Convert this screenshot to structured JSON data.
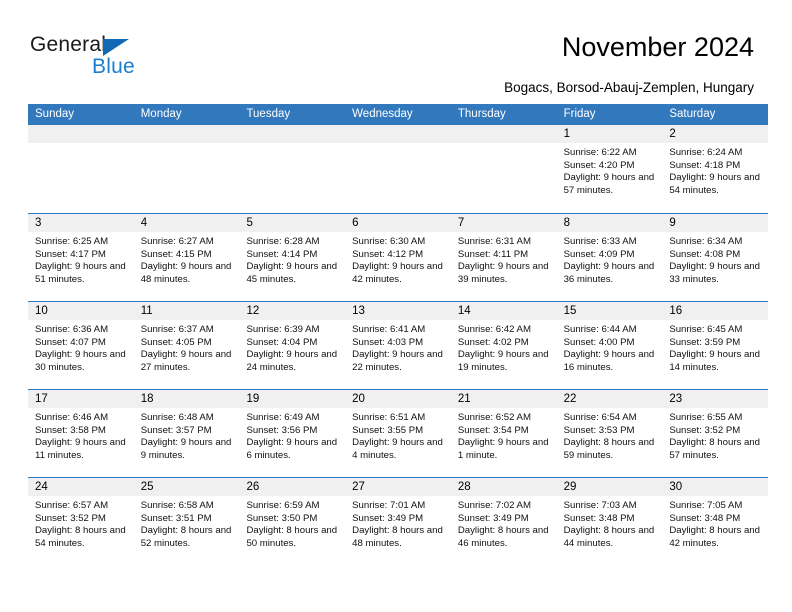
{
  "brand": {
    "name_part1": "General",
    "name_part2": "Blue",
    "accent_color": "#1a7fd4",
    "triangle_color": "#1268b3",
    "triangle_icon": "triangle-icon"
  },
  "header": {
    "title": "November 2024",
    "subtitle": "Bogacs, Borsod-Abauj-Zemplen, Hungary"
  },
  "calendar": {
    "header_bg": "#3278bd",
    "day_band_bg": "#f0f0f0",
    "weekdays": [
      "Sunday",
      "Monday",
      "Tuesday",
      "Wednesday",
      "Thursday",
      "Friday",
      "Saturday"
    ],
    "labels": {
      "sunrise": "Sunrise:",
      "sunset": "Sunset:",
      "daylight": "Daylight:"
    },
    "weeks": [
      [
        {
          "day": "",
          "empty": true
        },
        {
          "day": "",
          "empty": true
        },
        {
          "day": "",
          "empty": true
        },
        {
          "day": "",
          "empty": true
        },
        {
          "day": "",
          "empty": true
        },
        {
          "day": "1",
          "sunrise": "Sunrise: 6:22 AM",
          "sunset": "Sunset: 4:20 PM",
          "daylight": "Daylight: 9 hours and 57 minutes."
        },
        {
          "day": "2",
          "sunrise": "Sunrise: 6:24 AM",
          "sunset": "Sunset: 4:18 PM",
          "daylight": "Daylight: 9 hours and 54 minutes."
        }
      ],
      [
        {
          "day": "3",
          "sunrise": "Sunrise: 6:25 AM",
          "sunset": "Sunset: 4:17 PM",
          "daylight": "Daylight: 9 hours and 51 minutes."
        },
        {
          "day": "4",
          "sunrise": "Sunrise: 6:27 AM",
          "sunset": "Sunset: 4:15 PM",
          "daylight": "Daylight: 9 hours and 48 minutes."
        },
        {
          "day": "5",
          "sunrise": "Sunrise: 6:28 AM",
          "sunset": "Sunset: 4:14 PM",
          "daylight": "Daylight: 9 hours and 45 minutes."
        },
        {
          "day": "6",
          "sunrise": "Sunrise: 6:30 AM",
          "sunset": "Sunset: 4:12 PM",
          "daylight": "Daylight: 9 hours and 42 minutes."
        },
        {
          "day": "7",
          "sunrise": "Sunrise: 6:31 AM",
          "sunset": "Sunset: 4:11 PM",
          "daylight": "Daylight: 9 hours and 39 minutes."
        },
        {
          "day": "8",
          "sunrise": "Sunrise: 6:33 AM",
          "sunset": "Sunset: 4:09 PM",
          "daylight": "Daylight: 9 hours and 36 minutes."
        },
        {
          "day": "9",
          "sunrise": "Sunrise: 6:34 AM",
          "sunset": "Sunset: 4:08 PM",
          "daylight": "Daylight: 9 hours and 33 minutes."
        }
      ],
      [
        {
          "day": "10",
          "sunrise": "Sunrise: 6:36 AM",
          "sunset": "Sunset: 4:07 PM",
          "daylight": "Daylight: 9 hours and 30 minutes."
        },
        {
          "day": "11",
          "sunrise": "Sunrise: 6:37 AM",
          "sunset": "Sunset: 4:05 PM",
          "daylight": "Daylight: 9 hours and 27 minutes."
        },
        {
          "day": "12",
          "sunrise": "Sunrise: 6:39 AM",
          "sunset": "Sunset: 4:04 PM",
          "daylight": "Daylight: 9 hours and 24 minutes."
        },
        {
          "day": "13",
          "sunrise": "Sunrise: 6:41 AM",
          "sunset": "Sunset: 4:03 PM",
          "daylight": "Daylight: 9 hours and 22 minutes."
        },
        {
          "day": "14",
          "sunrise": "Sunrise: 6:42 AM",
          "sunset": "Sunset: 4:02 PM",
          "daylight": "Daylight: 9 hours and 19 minutes."
        },
        {
          "day": "15",
          "sunrise": "Sunrise: 6:44 AM",
          "sunset": "Sunset: 4:00 PM",
          "daylight": "Daylight: 9 hours and 16 minutes."
        },
        {
          "day": "16",
          "sunrise": "Sunrise: 6:45 AM",
          "sunset": "Sunset: 3:59 PM",
          "daylight": "Daylight: 9 hours and 14 minutes."
        }
      ],
      [
        {
          "day": "17",
          "sunrise": "Sunrise: 6:46 AM",
          "sunset": "Sunset: 3:58 PM",
          "daylight": "Daylight: 9 hours and 11 minutes."
        },
        {
          "day": "18",
          "sunrise": "Sunrise: 6:48 AM",
          "sunset": "Sunset: 3:57 PM",
          "daylight": "Daylight: 9 hours and 9 minutes."
        },
        {
          "day": "19",
          "sunrise": "Sunrise: 6:49 AM",
          "sunset": "Sunset: 3:56 PM",
          "daylight": "Daylight: 9 hours and 6 minutes."
        },
        {
          "day": "20",
          "sunrise": "Sunrise: 6:51 AM",
          "sunset": "Sunset: 3:55 PM",
          "daylight": "Daylight: 9 hours and 4 minutes."
        },
        {
          "day": "21",
          "sunrise": "Sunrise: 6:52 AM",
          "sunset": "Sunset: 3:54 PM",
          "daylight": "Daylight: 9 hours and 1 minute."
        },
        {
          "day": "22",
          "sunrise": "Sunrise: 6:54 AM",
          "sunset": "Sunset: 3:53 PM",
          "daylight": "Daylight: 8 hours and 59 minutes."
        },
        {
          "day": "23",
          "sunrise": "Sunrise: 6:55 AM",
          "sunset": "Sunset: 3:52 PM",
          "daylight": "Daylight: 8 hours and 57 minutes."
        }
      ],
      [
        {
          "day": "24",
          "sunrise": "Sunrise: 6:57 AM",
          "sunset": "Sunset: 3:52 PM",
          "daylight": "Daylight: 8 hours and 54 minutes."
        },
        {
          "day": "25",
          "sunrise": "Sunrise: 6:58 AM",
          "sunset": "Sunset: 3:51 PM",
          "daylight": "Daylight: 8 hours and 52 minutes."
        },
        {
          "day": "26",
          "sunrise": "Sunrise: 6:59 AM",
          "sunset": "Sunset: 3:50 PM",
          "daylight": "Daylight: 8 hours and 50 minutes."
        },
        {
          "day": "27",
          "sunrise": "Sunrise: 7:01 AM",
          "sunset": "Sunset: 3:49 PM",
          "daylight": "Daylight: 8 hours and 48 minutes."
        },
        {
          "day": "28",
          "sunrise": "Sunrise: 7:02 AM",
          "sunset": "Sunset: 3:49 PM",
          "daylight": "Daylight: 8 hours and 46 minutes."
        },
        {
          "day": "29",
          "sunrise": "Sunrise: 7:03 AM",
          "sunset": "Sunset: 3:48 PM",
          "daylight": "Daylight: 8 hours and 44 minutes."
        },
        {
          "day": "30",
          "sunrise": "Sunrise: 7:05 AM",
          "sunset": "Sunset: 3:48 PM",
          "daylight": "Daylight: 8 hours and 42 minutes."
        }
      ]
    ]
  }
}
